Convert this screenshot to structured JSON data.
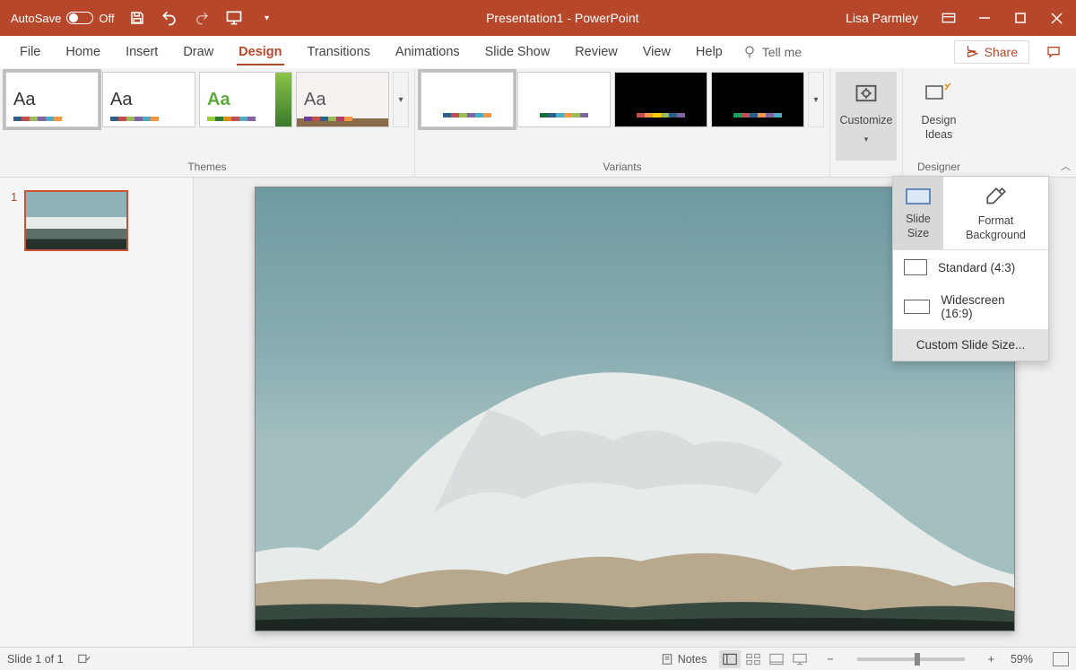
{
  "titlebar": {
    "autosave_label": "AutoSave",
    "autosave_state": "Off",
    "doc_title": "Presentation1  -  PowerPoint",
    "user": "Lisa Parmley"
  },
  "tabs": {
    "items": [
      "File",
      "Home",
      "Insert",
      "Draw",
      "Design",
      "Transitions",
      "Animations",
      "Slide Show",
      "Review",
      "View",
      "Help"
    ],
    "active": "Design",
    "tellme": "Tell me",
    "share": "Share"
  },
  "ribbon": {
    "themes_label": "Themes",
    "variants_label": "Variants",
    "customize_label": "Customize",
    "design_ideas_label": "Design\nIdeas",
    "designer_label": "Designer"
  },
  "popup": {
    "slide_size_label": "Slide\nSize",
    "format_bg_label": "Format\nBackground",
    "options": {
      "standard": "Standard (4:3)",
      "widescreen": "Widescreen (16:9)",
      "custom": "Custom Slide Size..."
    }
  },
  "slidepanel": {
    "slides": [
      {
        "num": "1"
      }
    ]
  },
  "status": {
    "slide_info": "Slide 1 of 1",
    "notes": "Notes",
    "zoom": "59%"
  }
}
